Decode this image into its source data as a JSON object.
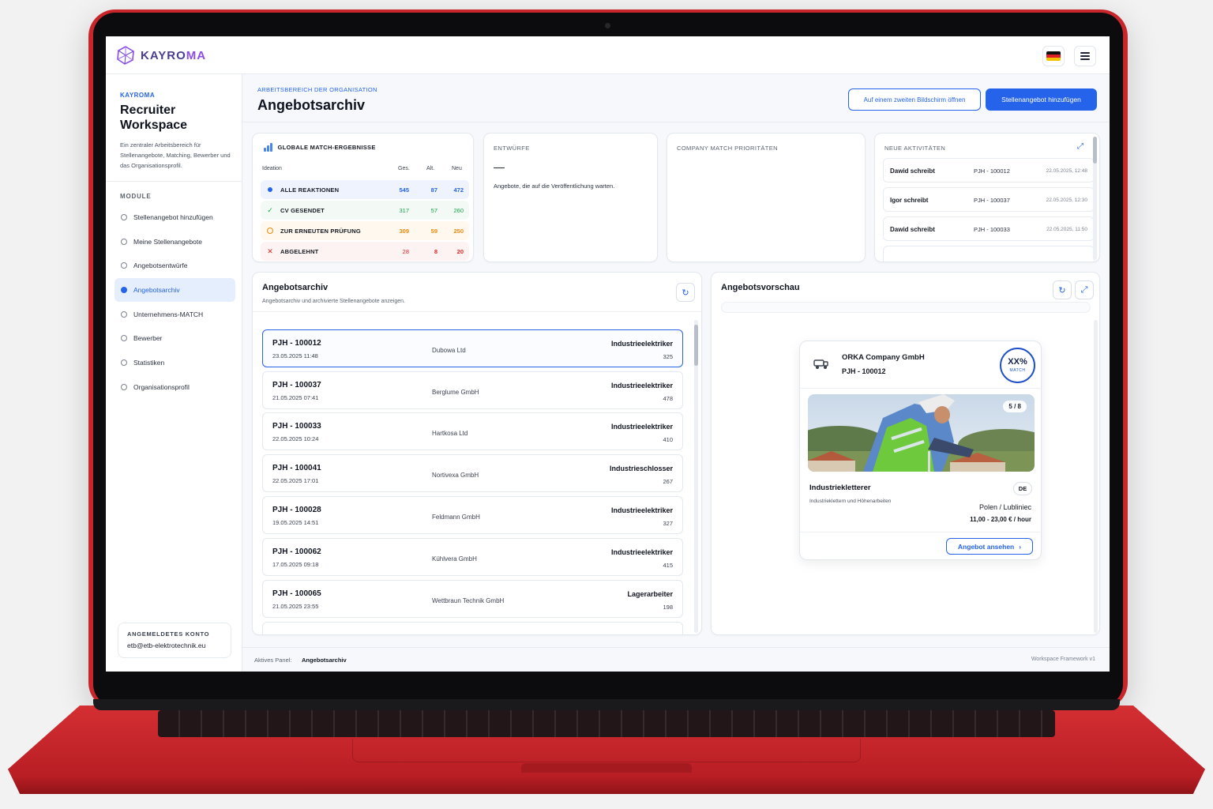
{
  "brand": {
    "logo_text_a": "KAYRO",
    "logo_text_b": "MA",
    "colors": {
      "primary": "#2563eb",
      "frame": "#c9262c",
      "logo": "#8b4de8"
    }
  },
  "topbar": {
    "language_icon": "flag-de-icon",
    "menu_icon": "hamburger-menu-icon"
  },
  "sidebar": {
    "brand": "KAYROMA",
    "title": "Recruiter Workspace",
    "description": "Ein zentraler Arbeitsbereich für Stellenangebote, Matching, Bewerber und das Organisationsprofil.",
    "section_label": "MODULE",
    "items": [
      {
        "label": "Stellenangebot hinzufügen",
        "active": false
      },
      {
        "label": "Meine Stellenangebote",
        "active": false
      },
      {
        "label": "Angebotsentwürfe",
        "active": false
      },
      {
        "label": "Angebotsarchiv",
        "active": true
      },
      {
        "label": "Unternehmens-MATCH",
        "active": false
      },
      {
        "label": "Bewerber",
        "active": false
      },
      {
        "label": "Statistiken",
        "active": false
      },
      {
        "label": "Organisationsprofil",
        "active": false
      }
    ],
    "account": {
      "label": "ANGEMELDETES KONTO",
      "email": "etb@etb-elektrotechnik.eu"
    }
  },
  "header": {
    "breadcrumb": "ARBEITSBEREICH DER ORGANISATION",
    "title": "Angebotsarchiv",
    "second_screen_button": "Auf einem zweiten Bildschirm öffnen",
    "add_offer_button": "Stellenangebot hinzufügen"
  },
  "global_match": {
    "title": "GLOBALE MATCH-ERGEBNISSE",
    "columns": {
      "name": "Ideation",
      "total": "Ges.",
      "old": "Alt.",
      "new": "Neu"
    },
    "rows": [
      {
        "label": "ALLE REAKTIONEN",
        "total": "545",
        "old": "87",
        "new": "472",
        "color": "#2563eb",
        "bg": "#eef3fd",
        "icon": "dot-icon"
      },
      {
        "label": "CV GESENDET",
        "total": "317",
        "old": "57",
        "new": "260",
        "color": "#16a34a",
        "bg": "#f3faf5",
        "icon": "check-icon"
      },
      {
        "label": "ZUR ERNEUTEN PRÜFUNG",
        "total": "309",
        "old": "59",
        "new": "250",
        "color": "#ea8a0c",
        "bg": "#fff8ee",
        "icon": "circle-icon"
      },
      {
        "label": "ABGELEHNT",
        "total": "28",
        "old": "8",
        "new": "20",
        "color": "#dc2626",
        "bg": "#fdf3f3",
        "icon": "cross-icon"
      }
    ]
  },
  "drafts": {
    "title": "ENTWÜRFE",
    "value": "—",
    "description": "Angebote, die auf die Veröffentlichung warten."
  },
  "company_match": {
    "title": "COMPANY MATCH PRIORITÄTEN"
  },
  "activities": {
    "title": "NEUE AKTIVITÄTEN",
    "items": [
      {
        "name": "Dawid schreibt",
        "id": "PJH - 100012",
        "time": "22.05.2025, 12:48"
      },
      {
        "name": "Igor schreibt",
        "id": "PJH - 100037",
        "time": "22.05.2025, 12:30"
      },
      {
        "name": "Dawid schreibt",
        "id": "PJH - 100033",
        "time": "22.05.2025, 11:50"
      }
    ]
  },
  "archive": {
    "title": "Angebotsarchiv",
    "subtitle": "Angebotsarchiv und archivierte Stellenangebote anzeigen.",
    "rows": [
      {
        "id": "PJH - 100012",
        "date": "23.05.2025 11:48",
        "company": "Dubowa Ltd",
        "role": "Industrieelektriker",
        "count": "325",
        "selected": true
      },
      {
        "id": "PJH - 100037",
        "date": "21.05.2025 07:41",
        "company": "Berglume GmbH",
        "role": "Industrieelektriker",
        "count": "478",
        "selected": false
      },
      {
        "id": "PJH - 100033",
        "date": "22.05.2025 10:24",
        "company": "Hartkosa Ltd",
        "role": "Industrieelektriker",
        "count": "410",
        "selected": false
      },
      {
        "id": "PJH - 100041",
        "date": "22.05.2025 17:01",
        "company": "Nortivexa GmbH",
        "role": "Industrieschlosser",
        "count": "267",
        "selected": false
      },
      {
        "id": "PJH - 100028",
        "date": "19.05.2025 14:51",
        "company": "Feldmann GmbH",
        "role": "Industrieelektriker",
        "count": "327",
        "selected": false
      },
      {
        "id": "PJH - 100062",
        "date": "17.05.2025 09:18",
        "company": "Kühlvera GmbH",
        "role": "Industrieelektriker",
        "count": "415",
        "selected": false
      },
      {
        "id": "PJH - 100065",
        "date": "21.05.2025 23:55",
        "company": "Wettbraun Technik GmbH",
        "role": "Lagerarbeiter",
        "count": "198",
        "selected": false
      }
    ]
  },
  "preview": {
    "title": "Angebotsvorschau",
    "company": "ORKA Company GmbH",
    "id": "PJH - 100012",
    "match_value": "XX%",
    "match_label": "MATCH",
    "photo_counter": "5 / 8",
    "job_title": "Industriekletterer",
    "language": "DE",
    "description": "Industrieklettern und Höhenarbeiten",
    "location": "Polen / Lubliniec",
    "pay": "11,00 - 23,00 € / hour",
    "button": "Angebot ansehen"
  },
  "footer": {
    "active_label": "Aktives Panel:",
    "active_value": "Angebotsarchiv",
    "version": "Workspace Framework v1"
  }
}
